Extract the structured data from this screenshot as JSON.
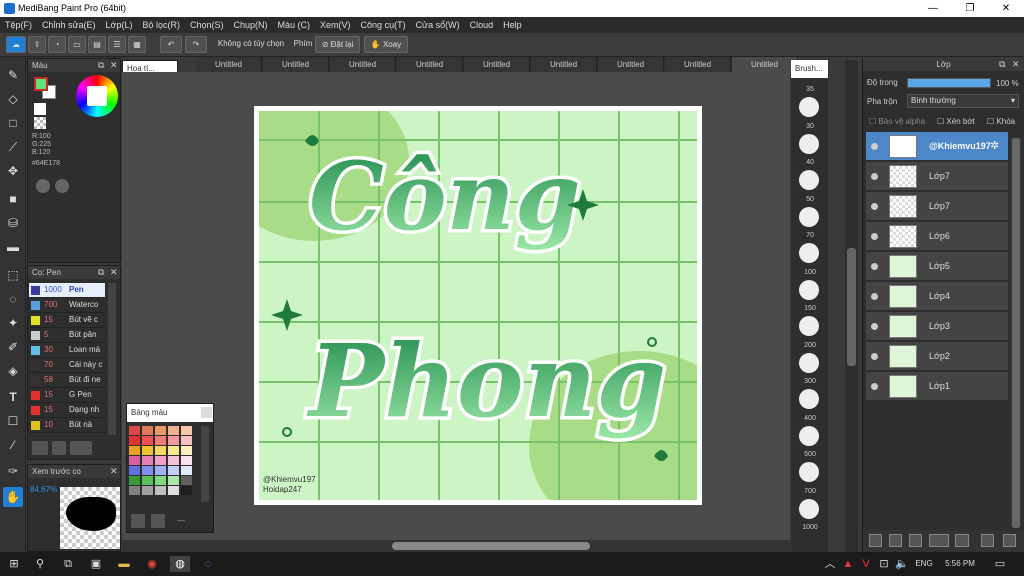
{
  "window": {
    "title": "MediBang Paint Pro (64bit)",
    "minimize": "—",
    "maximize": "❐",
    "close": "✕"
  },
  "menu": [
    "Tệp(F)",
    "Chỉnh sửa(E)",
    "Lớp(L)",
    "Bộ lọc(R)",
    "Chọn(S)",
    "Chụp(N)",
    "Màu (C)",
    "Xem(V)",
    "Công cụ(T)",
    "Cửa sổ(W)",
    "Cloud",
    "Help"
  ],
  "toolbar": {
    "no_antialias": "Không có tùy chọn",
    "shortcut_label": "Phím",
    "reset": "Đặt lại",
    "rotate": "Xoay"
  },
  "color_panel": {
    "title": "Màu",
    "r": "R:100",
    "g": "G:225",
    "b": "B:120",
    "hex": "#64E178",
    "primary": "#64e178",
    "secondary": "#ffffff"
  },
  "brush_panel": {
    "title": "Cọ: Pen",
    "items": [
      {
        "size": "1000",
        "name": "Pen",
        "color": "#3a3aa0",
        "sel": true
      },
      {
        "size": "700",
        "name": "Waterco",
        "color": "#5aa0e0",
        "sel": false
      },
      {
        "size": "15",
        "name": "Bút vẽ c",
        "color": "#e0e020",
        "sel": false
      },
      {
        "size": "5",
        "name": "Bút pân",
        "color": "#cccccc",
        "sel": false
      },
      {
        "size": "30",
        "name": "Loan mà",
        "color": "#60c0e0",
        "sel": false
      },
      {
        "size": "70",
        "name": "Cái này c",
        "color": "#333333",
        "sel": false
      },
      {
        "size": "58",
        "name": "Bút đi ne",
        "color": "#333333",
        "sel": false
      },
      {
        "size": "15",
        "name": "G Pen",
        "color": "#e03030",
        "sel": false
      },
      {
        "size": "15",
        "name": "Dạng nh",
        "color": "#e03030",
        "sel": false
      },
      {
        "size": "10",
        "name": "Bút nà",
        "color": "#e0c020",
        "sel": false
      }
    ]
  },
  "preview_panel": {
    "title": "Xem trước co",
    "zoom": "84.67%"
  },
  "hoa_panel": {
    "title": "Hoa tí..."
  },
  "palette_panel": {
    "title": "Bảng màu",
    "more": "---"
  },
  "doc_tabs": [
    "Untitled",
    "Untitled",
    "Untitled",
    "Untitled",
    "Untitled",
    "Untitled",
    "Untitled",
    "Untitled",
    "Untitled"
  ],
  "artwork": {
    "line1": "Công",
    "line2": "Phong",
    "credit1": "@Khiemvu197",
    "credit2": "Hoidap247"
  },
  "brush_sizes": {
    "title": "Brush...",
    "sizes": [
      "35",
      "30",
      "40",
      "50",
      "70",
      "100",
      "150",
      "200",
      "300",
      "400",
      "500",
      "700",
      "1000"
    ]
  },
  "layer_panel": {
    "title": "Lớp",
    "opacity_label": "Độ trong",
    "opacity_value": "100 %",
    "opacity": 1.0,
    "blend_label": "Pha trộn",
    "blend_value": "Bình thường",
    "protect_alpha": "Bảo vệ alpha",
    "clip": "Xén bớt",
    "lock": "Khóa",
    "layers": [
      {
        "name": "@Khiemvu197",
        "sel": true
      },
      {
        "name": "Lớp7",
        "sel": false
      },
      {
        "name": "Lớp7",
        "sel": false
      },
      {
        "name": "Lớp6",
        "sel": false
      },
      {
        "name": "Lớp5",
        "sel": false
      },
      {
        "name": "Lớp4",
        "sel": false
      },
      {
        "name": "Lớp3",
        "sel": false
      },
      {
        "name": "Lớp2",
        "sel": false
      },
      {
        "name": "Lớp1",
        "sel": false
      }
    ]
  },
  "taskbar": {
    "lang": "ENG",
    "time": "5:56 PM"
  }
}
